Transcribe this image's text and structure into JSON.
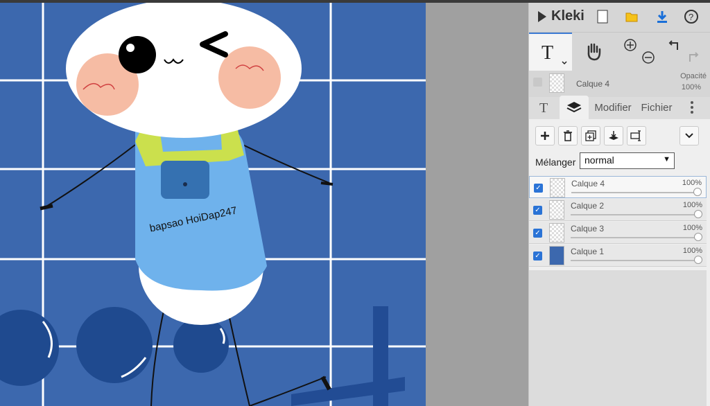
{
  "app": {
    "logo": "Kleki"
  },
  "canvas": {
    "watermark_text": "bapsao HoiDap247",
    "bg_color": "#3c68ae",
    "grid_color": "#ffffff"
  },
  "top_icons": [
    "new-file-icon",
    "open-folder-icon",
    "download-icon",
    "help-icon"
  ],
  "tools": [
    "text-tool-icon",
    "hand-tool-icon",
    "zoom-in-icon",
    "zoom-out-icon",
    "undo-icon",
    "redo-icon"
  ],
  "current_layer": {
    "name": "Calque 4",
    "opacity_label": "Opacité",
    "opacity_value": "100%"
  },
  "tabs": {
    "text_icon": "text-tab-icon",
    "layers_icon": "layers-tab-icon",
    "modifier": "Modifier",
    "fichier": "Fichier"
  },
  "layer_buttons": [
    "add-layer-icon",
    "delete-layer-icon",
    "duplicate-layer-icon",
    "merge-down-icon",
    "rename-layer-icon",
    "chevron-down-icon"
  ],
  "blend": {
    "label": "Mélanger",
    "value": "normal"
  },
  "layers": [
    {
      "name": "Calque 4",
      "opacity": "100%"
    },
    {
      "name": "Calque 2",
      "opacity": "100%"
    },
    {
      "name": "Calque 3",
      "opacity": "100%"
    },
    {
      "name": "Calque 1",
      "opacity": "100%"
    }
  ],
  "colors": {
    "accent": "#2a73d6",
    "panel_bg": "#efefef"
  }
}
